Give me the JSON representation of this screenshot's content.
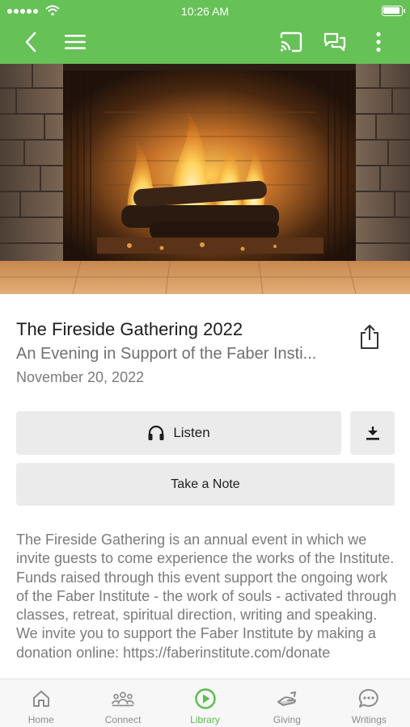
{
  "status_bar": {
    "time": "10:26 AM"
  },
  "app_bar": {
    "icons": [
      "back-arrow-icon",
      "menu-icon",
      "cast-icon",
      "chat-icon",
      "more-vert-icon"
    ],
    "color": "#66c157"
  },
  "hero": {
    "icon": "fireplace-image"
  },
  "content": {
    "title": "The Fireside Gathering 2022",
    "subtitle": "An Evening in Support of the Faber Insti...",
    "date": "November 20, 2022",
    "listen_label": "Listen",
    "take_note_label": "Take a Note",
    "description": "The Fireside Gathering is an annual event in which we invite guests to come experience the works of the Institute. Funds raised through this event support the ongoing work of the Faber Institute - the work of souls - activated through classes, retreat, spiritual direction, writing and speaking. We invite you to support the Faber Institute by making a donation online: https://faberinstitute.com/donate"
  },
  "tabs": [
    {
      "label": "Home",
      "icon": "home-icon",
      "active": false
    },
    {
      "label": "Connect",
      "icon": "people-icon",
      "active": false
    },
    {
      "label": "Library",
      "icon": "play-circle-icon",
      "active": true
    },
    {
      "label": "Giving",
      "icon": "giving-hand-icon",
      "active": false
    },
    {
      "label": "Writings",
      "icon": "chat-bubble-icon",
      "active": false
    }
  ],
  "colors": {
    "accent": "#5bbd4c",
    "button_bg": "#ebebeb",
    "text_muted": "#7b7b7b"
  }
}
